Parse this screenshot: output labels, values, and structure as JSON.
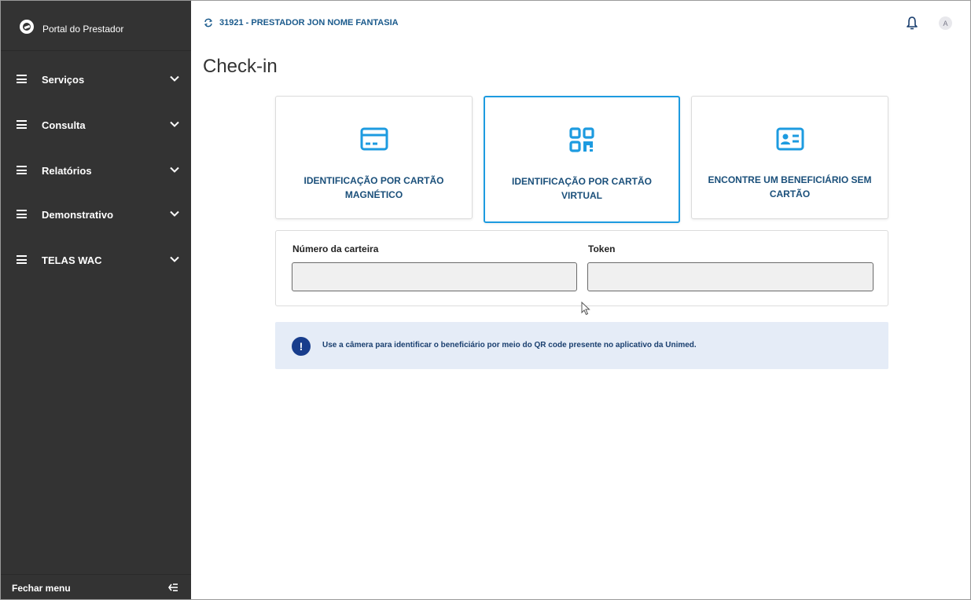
{
  "sidebar": {
    "brand_title": "Portal do Prestador",
    "items": [
      {
        "label": "Serviços"
      },
      {
        "label": "Consulta"
      },
      {
        "label": "Relatórios"
      },
      {
        "label": "Demonstrativo"
      },
      {
        "label": "TELAS WAC"
      }
    ],
    "collapse_label": "Fechar menu"
  },
  "header": {
    "provider": "31921 - PRESTADOR JON NOME FANTASIA",
    "avatar_initial": "A"
  },
  "main": {
    "title": "Check-in",
    "cards": [
      {
        "icon": "credit-card-icon",
        "label": "IDENTIFICAÇÃO POR CARTÃO MAGNÉTICO",
        "active": false
      },
      {
        "icon": "qr-code-icon",
        "label": "IDENTIFICAÇÃO POR CARTÃO VIRTUAL",
        "active": true
      },
      {
        "icon": "id-card-icon",
        "label": "ENCONTRE UM BENEFICIÁRIO SEM CARTÃO",
        "active": false
      }
    ],
    "form": {
      "card_number_label": "Número da carteira",
      "card_number_value": "",
      "token_label": "Token",
      "token_value": ""
    },
    "alert": {
      "icon_text": "!",
      "text": "Use a câmera para identificar o beneficiário por meio do QR code presente no aplicativo da Unimed."
    }
  },
  "colors": {
    "sidebar_bg": "#333333",
    "accent": "#1d9be0",
    "label_blue": "#1a4f7a",
    "alert_bg": "#e5ecf7",
    "alert_icon": "#183d8c"
  }
}
